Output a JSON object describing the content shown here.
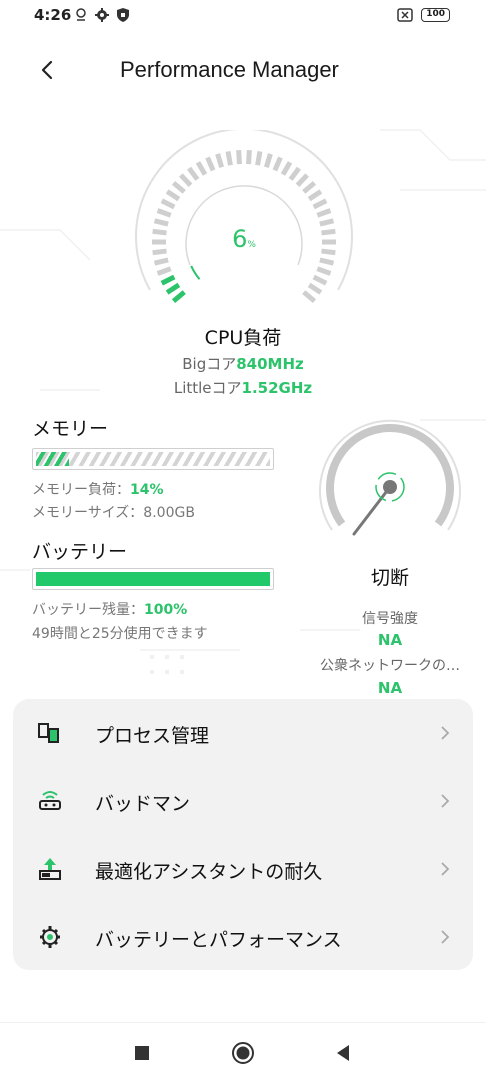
{
  "status_bar": {
    "time": "4:26",
    "battery": "100"
  },
  "header": {
    "title": "Performance Manager"
  },
  "cpu": {
    "value": "6",
    "unit": "%",
    "label": "CPU負荷",
    "big_prefix": "Bigコア",
    "big_value": "840MHz",
    "little_prefix": "Littleコア",
    "little_value": "1.52GHz"
  },
  "memory": {
    "title": "メモリー",
    "load_prefix": "メモリー負荷：",
    "load_value": "14%",
    "load_fraction": 0.14,
    "size_text": "メモリーサイズ：8.00GB"
  },
  "battery": {
    "title": "バッテリー",
    "remaining_prefix": "バッテリー残量：",
    "remaining_value": "100%",
    "level_fraction": 1.0,
    "usage_text": "49時間と25分使用できます"
  },
  "network": {
    "status": "切断",
    "signal_label": "信号強度",
    "signal_value": "NA",
    "public_label": "公衆ネットワークの…",
    "public_value": "NA"
  },
  "menu": {
    "items": [
      {
        "label": "プロセス管理",
        "icon": "process-icon"
      },
      {
        "label": "バッドマン",
        "icon": "router-icon"
      },
      {
        "label": "最適化アシスタントの耐久",
        "icon": "upload-battery-icon"
      },
      {
        "label": "バッテリーとパフォーマンス",
        "icon": "gear-icon"
      }
    ]
  },
  "colors": {
    "accent": "#2cc36b",
    "gauge_gray": "#c8c8c8",
    "card_bg": "#f2f2f2"
  }
}
